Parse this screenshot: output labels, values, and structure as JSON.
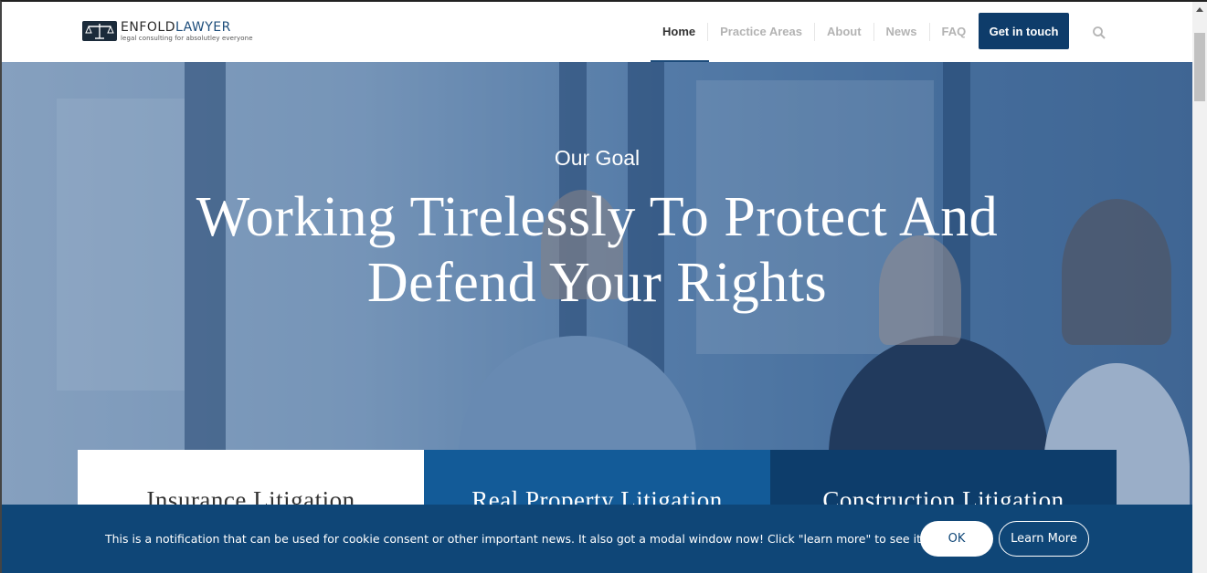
{
  "brand": {
    "name_part1": "ENFOLD",
    "name_part2": "LAWYER",
    "tagline": "legal consulting for absolutley everyone"
  },
  "nav": {
    "items": [
      {
        "label": "Home",
        "active": true
      },
      {
        "label": "Practice Areas"
      },
      {
        "label": "About"
      },
      {
        "label": "News"
      },
      {
        "label": "FAQ"
      }
    ],
    "cta_label": "Get in touch",
    "search_icon": "search-icon"
  },
  "hero": {
    "subtitle": "Our Goal",
    "title": "Working Tirelessly To Protect And Defend Your Rights"
  },
  "services": [
    {
      "title": "Insurance Litigation"
    },
    {
      "title": "Real Property Litigation"
    },
    {
      "title": "Construction Litigation"
    }
  ],
  "cookie": {
    "message": "This is a notification that can be used for cookie consent or other important news. It also got a modal window now! Click \"learn more\" to see it!",
    "ok_label": "OK",
    "learn_more_label": "Learn More"
  },
  "colors": {
    "primary": "#0e3c6a",
    "accent": "#135b98",
    "cookie_bg": "#0f4677"
  }
}
